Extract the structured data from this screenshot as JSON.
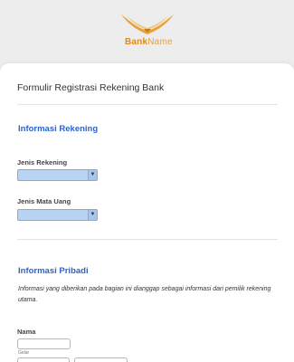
{
  "brand": {
    "name_part1": "Bank",
    "name_part2": "Name",
    "accent": "#e8a23a"
  },
  "form": {
    "title": "Formulir Registrasi Rekening Bank",
    "section_account": {
      "title": "Informasi Rekening",
      "fields": [
        {
          "label": "Jenis Rekening",
          "value": ""
        },
        {
          "label": "Jenis Mata Uang",
          "value": ""
        }
      ]
    },
    "section_personal": {
      "title": "Informasi Pribadi",
      "description": "Informasi yang diberikan pada bagian ini dianggap sebagai informasi dari pemilik rekening utama.",
      "name_label": "Nama",
      "title_sublabel": "Gelar"
    }
  },
  "colors": {
    "section_title": "#2d63c8",
    "select_fill": "#b9d3f2"
  },
  "icons": {
    "logo": "bird-wings-icon",
    "dropdown": "chevron-down-icon"
  }
}
